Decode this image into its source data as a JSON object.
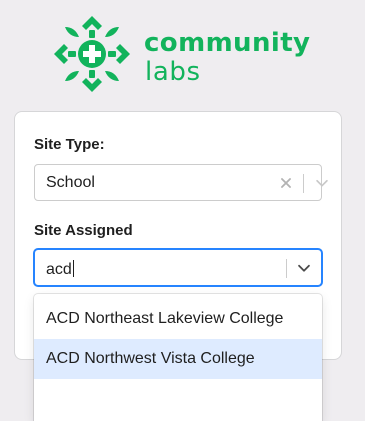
{
  "brand": {
    "line1": "community",
    "line2": "labs",
    "color": "#12b35c"
  },
  "form": {
    "site_type": {
      "label": "Site Type:",
      "value": "School"
    },
    "site_assigned": {
      "label": "Site Assigned",
      "input_value": "acd",
      "focus_color": "#2684ff"
    }
  },
  "dropdown": {
    "options": [
      {
        "label": "ACD Northeast Lakeview College",
        "focused": false
      },
      {
        "label": "ACD Northwest Vista College",
        "focused": true
      }
    ],
    "focused_color": "#deebff"
  },
  "icons": {
    "logo": "community-labs-logo-icon",
    "clear": "close-icon",
    "chevron": "chevron-down-icon"
  }
}
